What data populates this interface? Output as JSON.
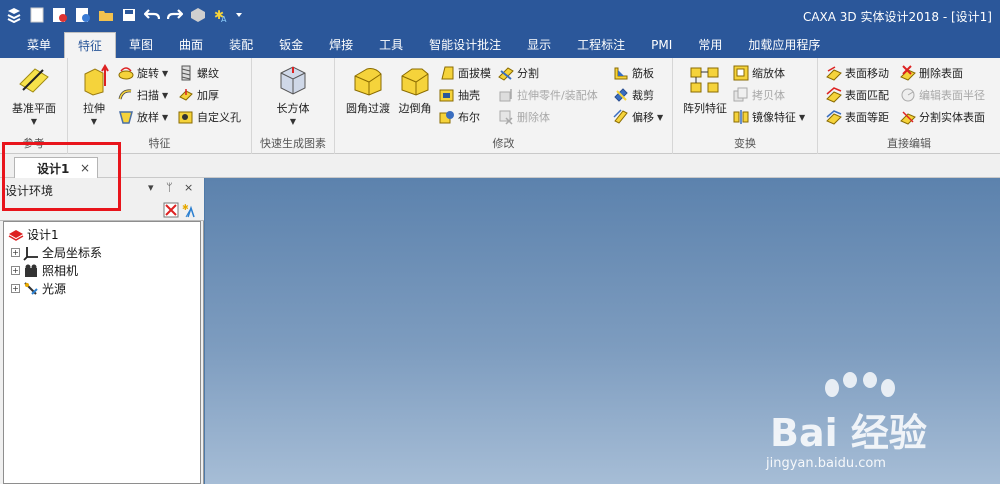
{
  "title_bar": {
    "title": "CAXA 3D 实体设计2018 - [设计1]",
    "quick_access_icons": [
      "app-menu-icon",
      "new-file-icon",
      "new-design-icon",
      "open-file-icon",
      "folder-icon",
      "save-icon",
      "undo-icon",
      "redo-icon",
      "cube-icon",
      "sparkle-icon",
      "dropdown-icon"
    ]
  },
  "ribbon_tabs": [
    "菜单",
    "特征",
    "草图",
    "曲面",
    "装配",
    "钣金",
    "焊接",
    "工具",
    "智能设计批注",
    "显示",
    "工程标注",
    "PMI",
    "常用",
    "加载应用程序"
  ],
  "active_tab": "特征",
  "groups": {
    "reference": {
      "label": "参考",
      "datum_plane": "基准平面"
    },
    "feature": {
      "label": "特征",
      "extrude": "拉伸",
      "revolve": "旋转",
      "sweep": "扫描",
      "loft": "放样",
      "thread": "螺纹",
      "thicken": "加厚",
      "custom_hole": "自定义孔"
    },
    "quick_shape": {
      "label": "快速生成图素",
      "cuboid": "长方体"
    },
    "modify": {
      "label": "修改",
      "fillet": "圆角过渡",
      "chamfer": "边倒角",
      "draft": "面拔模",
      "shell": "抽壳",
      "boolean": "布尔",
      "split": "分割",
      "pull_part": "拉伸零件/装配体",
      "delete_body": "删除体",
      "rib": "筋板",
      "trim": "裁剪",
      "offset": "偏移"
    },
    "transform": {
      "label": "变换",
      "pattern": "阵列特征",
      "scale": "缩放体",
      "copy": "拷贝体",
      "mirror": "镜像特征"
    },
    "direct_edit": {
      "label": "直接编辑",
      "face_move": "表面移动",
      "face_match": "表面匹配",
      "face_offset": "表面等距",
      "delete_face": "删除表面",
      "edit_radius": "编辑表面半径",
      "split_body": "分割实体表面"
    }
  },
  "document_tab": {
    "label": "设计1",
    "close": "×"
  },
  "design_panel": {
    "title": "设计环境",
    "controls": [
      "▾",
      "ᛘ",
      "×"
    ],
    "tree": [
      {
        "label": "设计1",
        "expandable": false
      },
      {
        "label": "全局坐标系",
        "expandable": true
      },
      {
        "label": "照相机",
        "expandable": true
      },
      {
        "label": "光源",
        "expandable": true
      }
    ]
  },
  "watermark": {
    "brand": "Bai  经验",
    "url": "jingyan.baidu.com"
  },
  "colors": {
    "title_bar": "#2b579a",
    "ribbon": "#f3f3f3",
    "viewport_top": "#5c82ad",
    "highlight": "#e8141b"
  }
}
